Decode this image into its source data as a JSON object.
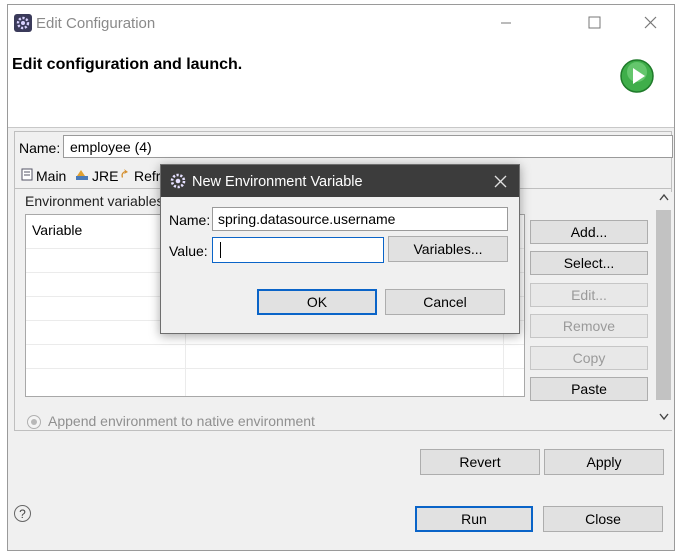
{
  "window": {
    "title": "Edit Configuration",
    "banner_title": "Edit configuration and launch.",
    "minimize_icon": "minimize-icon",
    "maximize_icon": "maximize-icon",
    "close_icon": "close-icon"
  },
  "config": {
    "name_label": "Name:",
    "name_value": "employee (4)"
  },
  "tabs": [
    {
      "label": "Main",
      "icon": "main-tab-icon"
    },
    {
      "label": "JRE",
      "icon": "jre-tab-icon"
    },
    {
      "label": "Refres",
      "icon": "refresh-tab-icon"
    }
  ],
  "environment": {
    "label": "Environment variables",
    "column_variable": "Variable",
    "buttons": {
      "add": "Add...",
      "select": "Select...",
      "edit": "Edit...",
      "remove": "Remove",
      "copy": "Copy",
      "paste": "Paste"
    },
    "append_label": "Append environment to native environment"
  },
  "footer": {
    "revert": "Revert",
    "apply": "Apply",
    "run": "Run",
    "close": "Close",
    "help_icon": "help-icon"
  },
  "dialog": {
    "title": "New Environment Variable",
    "name_label": "Name:",
    "name_value": "spring.datasource.username",
    "value_label": "Value:",
    "value_value": "",
    "variables_button": "Variables...",
    "ok": "OK",
    "cancel": "Cancel"
  },
  "colors": {
    "accent": "#0a64c8",
    "dialog_titlebar": "#3c3c3c",
    "run_icon": "#2e9e3a"
  }
}
